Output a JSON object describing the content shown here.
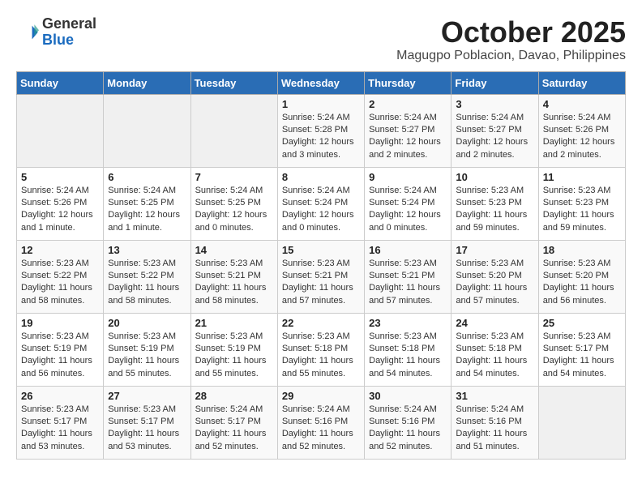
{
  "logo": {
    "general": "General",
    "blue": "Blue"
  },
  "title": "October 2025",
  "subtitle": "Magugpo Poblacion, Davao, Philippines",
  "days_of_week": [
    "Sunday",
    "Monday",
    "Tuesday",
    "Wednesday",
    "Thursday",
    "Friday",
    "Saturday"
  ],
  "weeks": [
    [
      {
        "day": "",
        "info": ""
      },
      {
        "day": "",
        "info": ""
      },
      {
        "day": "",
        "info": ""
      },
      {
        "day": "1",
        "info": "Sunrise: 5:24 AM\nSunset: 5:28 PM\nDaylight: 12 hours and 3 minutes."
      },
      {
        "day": "2",
        "info": "Sunrise: 5:24 AM\nSunset: 5:27 PM\nDaylight: 12 hours and 2 minutes."
      },
      {
        "day": "3",
        "info": "Sunrise: 5:24 AM\nSunset: 5:27 PM\nDaylight: 12 hours and 2 minutes."
      },
      {
        "day": "4",
        "info": "Sunrise: 5:24 AM\nSunset: 5:26 PM\nDaylight: 12 hours and 2 minutes."
      }
    ],
    [
      {
        "day": "5",
        "info": "Sunrise: 5:24 AM\nSunset: 5:26 PM\nDaylight: 12 hours and 1 minute."
      },
      {
        "day": "6",
        "info": "Sunrise: 5:24 AM\nSunset: 5:25 PM\nDaylight: 12 hours and 1 minute."
      },
      {
        "day": "7",
        "info": "Sunrise: 5:24 AM\nSunset: 5:25 PM\nDaylight: 12 hours and 0 minutes."
      },
      {
        "day": "8",
        "info": "Sunrise: 5:24 AM\nSunset: 5:24 PM\nDaylight: 12 hours and 0 minutes."
      },
      {
        "day": "9",
        "info": "Sunrise: 5:24 AM\nSunset: 5:24 PM\nDaylight: 12 hours and 0 minutes."
      },
      {
        "day": "10",
        "info": "Sunrise: 5:23 AM\nSunset: 5:23 PM\nDaylight: 11 hours and 59 minutes."
      },
      {
        "day": "11",
        "info": "Sunrise: 5:23 AM\nSunset: 5:23 PM\nDaylight: 11 hours and 59 minutes."
      }
    ],
    [
      {
        "day": "12",
        "info": "Sunrise: 5:23 AM\nSunset: 5:22 PM\nDaylight: 11 hours and 58 minutes."
      },
      {
        "day": "13",
        "info": "Sunrise: 5:23 AM\nSunset: 5:22 PM\nDaylight: 11 hours and 58 minutes."
      },
      {
        "day": "14",
        "info": "Sunrise: 5:23 AM\nSunset: 5:21 PM\nDaylight: 11 hours and 58 minutes."
      },
      {
        "day": "15",
        "info": "Sunrise: 5:23 AM\nSunset: 5:21 PM\nDaylight: 11 hours and 57 minutes."
      },
      {
        "day": "16",
        "info": "Sunrise: 5:23 AM\nSunset: 5:21 PM\nDaylight: 11 hours and 57 minutes."
      },
      {
        "day": "17",
        "info": "Sunrise: 5:23 AM\nSunset: 5:20 PM\nDaylight: 11 hours and 57 minutes."
      },
      {
        "day": "18",
        "info": "Sunrise: 5:23 AM\nSunset: 5:20 PM\nDaylight: 11 hours and 56 minutes."
      }
    ],
    [
      {
        "day": "19",
        "info": "Sunrise: 5:23 AM\nSunset: 5:19 PM\nDaylight: 11 hours and 56 minutes."
      },
      {
        "day": "20",
        "info": "Sunrise: 5:23 AM\nSunset: 5:19 PM\nDaylight: 11 hours and 55 minutes."
      },
      {
        "day": "21",
        "info": "Sunrise: 5:23 AM\nSunset: 5:19 PM\nDaylight: 11 hours and 55 minutes."
      },
      {
        "day": "22",
        "info": "Sunrise: 5:23 AM\nSunset: 5:18 PM\nDaylight: 11 hours and 55 minutes."
      },
      {
        "day": "23",
        "info": "Sunrise: 5:23 AM\nSunset: 5:18 PM\nDaylight: 11 hours and 54 minutes."
      },
      {
        "day": "24",
        "info": "Sunrise: 5:23 AM\nSunset: 5:18 PM\nDaylight: 11 hours and 54 minutes."
      },
      {
        "day": "25",
        "info": "Sunrise: 5:23 AM\nSunset: 5:17 PM\nDaylight: 11 hours and 54 minutes."
      }
    ],
    [
      {
        "day": "26",
        "info": "Sunrise: 5:23 AM\nSunset: 5:17 PM\nDaylight: 11 hours and 53 minutes."
      },
      {
        "day": "27",
        "info": "Sunrise: 5:23 AM\nSunset: 5:17 PM\nDaylight: 11 hours and 53 minutes."
      },
      {
        "day": "28",
        "info": "Sunrise: 5:24 AM\nSunset: 5:17 PM\nDaylight: 11 hours and 52 minutes."
      },
      {
        "day": "29",
        "info": "Sunrise: 5:24 AM\nSunset: 5:16 PM\nDaylight: 11 hours and 52 minutes."
      },
      {
        "day": "30",
        "info": "Sunrise: 5:24 AM\nSunset: 5:16 PM\nDaylight: 11 hours and 52 minutes."
      },
      {
        "day": "31",
        "info": "Sunrise: 5:24 AM\nSunset: 5:16 PM\nDaylight: 11 hours and 51 minutes."
      },
      {
        "day": "",
        "info": ""
      }
    ]
  ]
}
